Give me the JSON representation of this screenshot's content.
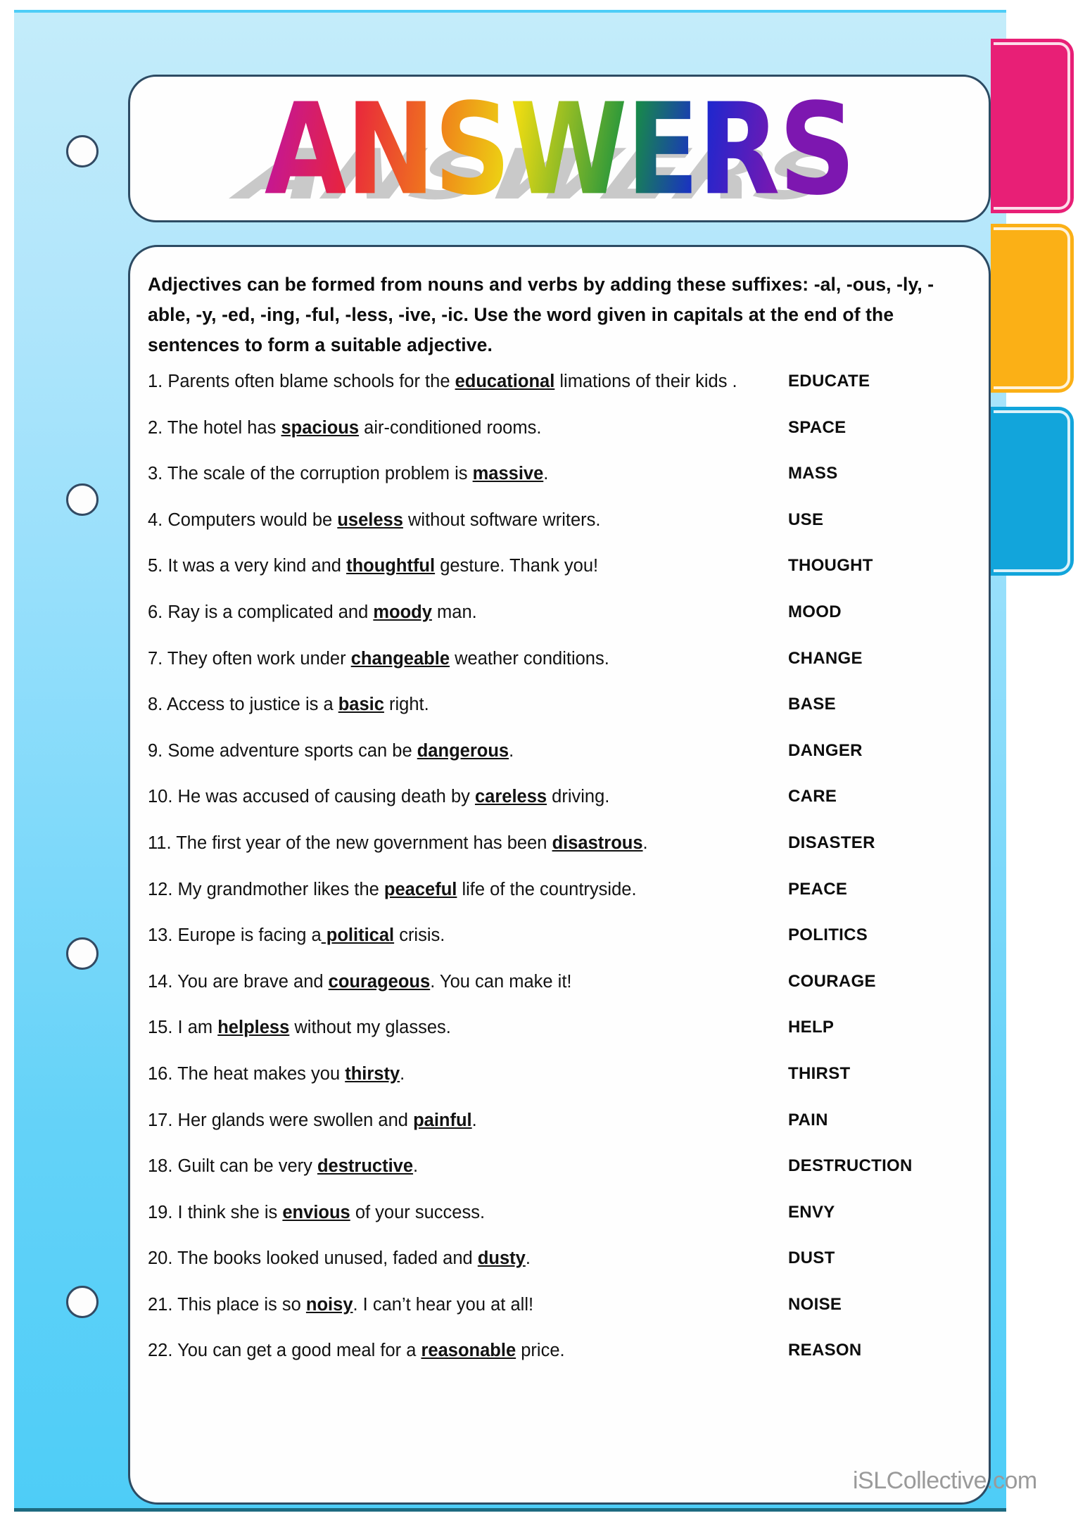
{
  "title": {
    "text": "ANSWERS",
    "letters": [
      {
        "char": "A",
        "color": "#c2169a"
      },
      {
        "char": "N",
        "color": "#e8243d"
      },
      {
        "char": "S",
        "color": "#f07d1b"
      },
      {
        "char": "W",
        "color": "#ecdb12"
      },
      {
        "char": "E",
        "color": "#17913f"
      },
      {
        "char": "R",
        "color": "#1a28cf"
      },
      {
        "char": "S",
        "color": "#7d17b0"
      }
    ]
  },
  "instructions": "Adjectives can be formed from nouns and verbs by adding these suffixes: -al, -ous, -ly, -able, -y, -ed, -ing, -ful, -less, -ive, -ic. Use the word given in capitals at the end of the sentences to form a suitable adjective.",
  "items": [
    {
      "num": "1.",
      "before": "Parents often blame schools for the ",
      "answer": "educational",
      "after": " limations of their kids .",
      "cue": "EDUCATE"
    },
    {
      "num": "2.",
      "before": "The hotel has ",
      "answer": "spacious",
      "after": " air-conditioned rooms.",
      "cue": "SPACE"
    },
    {
      "num": "3.",
      "before": "The scale of the corruption problem is ",
      "answer": "massive",
      "after": ".",
      "cue": "MASS"
    },
    {
      "num": "4.",
      "before": "Computers would be ",
      "answer": "useless",
      "after": " without software writers.",
      "cue": "USE"
    },
    {
      "num": "5.",
      "before": "It was a very kind and ",
      "answer": "thoughtful",
      "after": " gesture. Thank you!",
      "cue": "THOUGHT"
    },
    {
      "num": "6.",
      "before": "Ray is a complicated and ",
      "answer": "moody",
      "after": " man.",
      "cue": "MOOD"
    },
    {
      "num": "7.",
      "before": "They often work under ",
      "answer": "changeable",
      "after": " weather conditions.",
      "cue": "CHANGE"
    },
    {
      "num": "8.",
      "before": "Access to justice is a ",
      "answer": "basic",
      "after": " right.",
      "cue": "BASE"
    },
    {
      "num": "9.",
      "before": "Some adventure sports can be ",
      "answer": "dangerous",
      "after": ".",
      "cue": "DANGER"
    },
    {
      "num": "10.",
      "before": "He was accused of causing death by ",
      "answer": "careless",
      "after": " driving.",
      "cue": "CARE"
    },
    {
      "num": "11.",
      "before": "The first year of the new government has been ",
      "answer": "disastrous",
      "after": ".",
      "cue": "DISASTER"
    },
    {
      "num": "12.",
      "before": "My grandmother likes the ",
      "answer": "peaceful",
      "after": " life of the countryside.",
      "cue": "PEACE"
    },
    {
      "num": "13.",
      "before": "Europe is facing a",
      "answer": " political",
      "after": " crisis.",
      "cue": "POLITICS"
    },
    {
      "num": "14.",
      "before": "You are brave and ",
      "answer": "courageous",
      "after": ". You can make it!",
      "cue": "COURAGE"
    },
    {
      "num": "15.",
      "before": "I am ",
      "answer": "helpless",
      "after": " without my glasses.",
      "cue": "HELP"
    },
    {
      "num": "16.",
      "before": "The heat makes you ",
      "answer": "thirsty",
      "after": ".",
      "cue": "THIRST"
    },
    {
      "num": "17.",
      "before": "Her glands were swollen and ",
      "answer": "painful",
      "after": ".",
      "cue": "PAIN"
    },
    {
      "num": "18.",
      "before": "Guilt can be very ",
      "answer": "destructive",
      "after": ".",
      "cue": "DESTRUCTION"
    },
    {
      "num": "19.",
      "before": "I think she is ",
      "answer": "envious",
      "after": " of your success.",
      "cue": "ENVY"
    },
    {
      "num": "20.",
      "before": "The books looked unused, faded and ",
      "answer": "dusty",
      "after": ".",
      "cue": "DUST"
    },
    {
      "num": "21.",
      "before": "This place is so ",
      "answer": "noisy",
      "after": ". I can’t hear you at all!",
      "cue": "NOISE"
    },
    {
      "num": "22.",
      "before": "You can get a good meal for a ",
      "answer": "reasonable",
      "after": " price.",
      "cue": "REASON"
    }
  ],
  "tabs": [
    {
      "name": "pink-tab",
      "color": "#e81f76"
    },
    {
      "name": "orange-tab",
      "color": "#fbb016"
    },
    {
      "name": "blue-tab",
      "color": "#12a5db"
    }
  ],
  "holes": [
    215,
    710,
    1355,
    1850
  ],
  "watermark": "iSLCollective.com"
}
